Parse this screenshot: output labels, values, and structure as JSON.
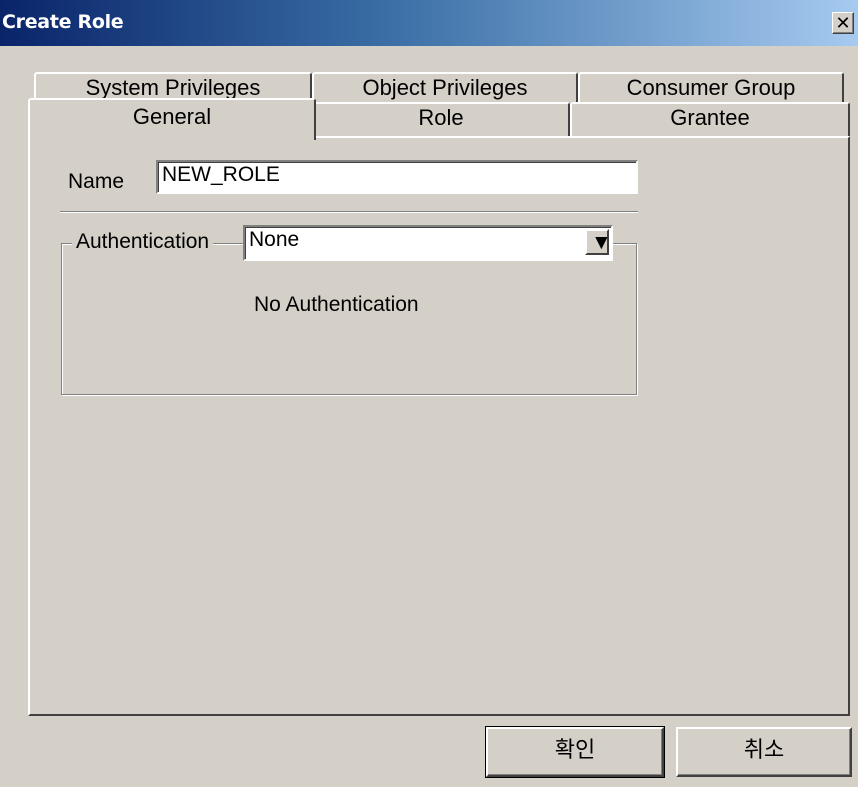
{
  "window": {
    "title": "Create Role",
    "close_glyph": "✕"
  },
  "tabs": {
    "back_row": [
      "System Privileges",
      "Object Privileges",
      "Consumer Group"
    ],
    "front_row": [
      "General",
      "Role",
      "Grantee"
    ],
    "active": "General"
  },
  "general": {
    "name_label": "Name",
    "name_value": "NEW_ROLE",
    "authentication_label": "Authentication",
    "authentication_value": "None",
    "authentication_description": "No Authentication"
  },
  "buttons": {
    "ok": "확인",
    "cancel": "취소"
  },
  "icons": {
    "close": "close-icon",
    "dropdown": "chevron-down-icon"
  }
}
